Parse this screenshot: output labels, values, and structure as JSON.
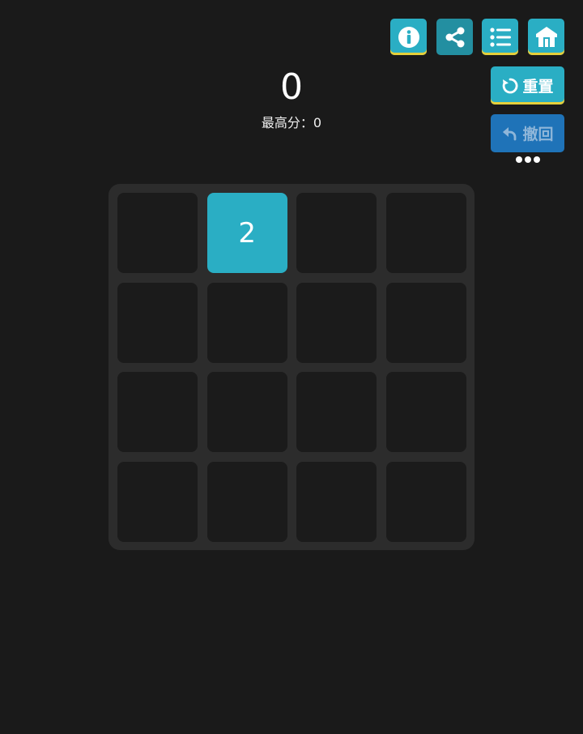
{
  "score": {
    "current": "0",
    "best_label": "最高分：0"
  },
  "toolbar": {
    "info_icon": "info-icon",
    "share_icon": "share-icon",
    "menu_icon": "list-icon",
    "home_icon": "home-icon"
  },
  "actions": {
    "reset_label": "重置",
    "undo_label": "撤回",
    "more_icon": "more-dots-icon"
  },
  "board": {
    "size": 4,
    "tiles": [
      {
        "row": 0,
        "col": 1,
        "value": "2"
      }
    ]
  },
  "colors": {
    "background": "#1a1a1a",
    "board": "#2c2c2c",
    "cell": "#1b1b1b",
    "accent": "#2aaec4",
    "share": "#238fa1",
    "undo": "#1f73b8",
    "underline": "#e6cf3a"
  }
}
